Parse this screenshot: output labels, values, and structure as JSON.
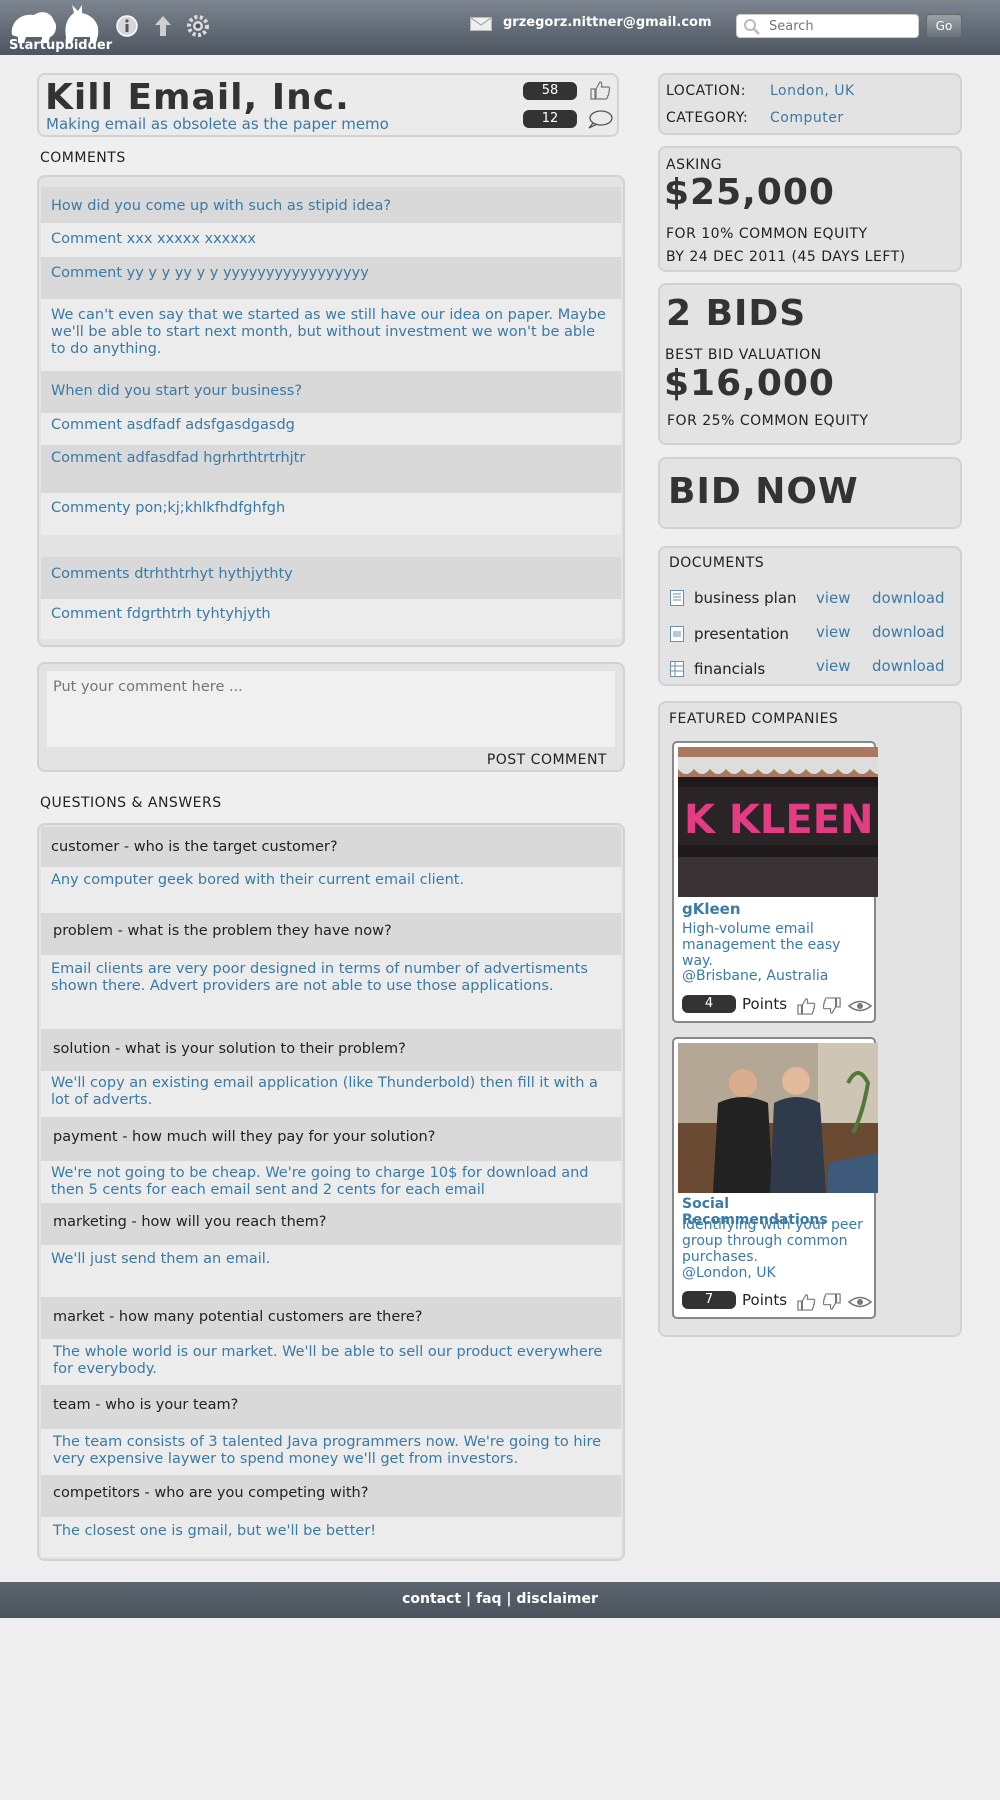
{
  "header": {
    "brand": "Startupbidder",
    "email": "grzegorz.nittner@gmail.com",
    "search_placeholder": "Search",
    "go_label": "Go"
  },
  "company": {
    "name": "Kill Email, Inc.",
    "tagline": "Making email as obsolete as the paper memo",
    "likes": "58",
    "comment_count": "12"
  },
  "comments": {
    "heading": "COMMENTS",
    "items": [
      "How did you come up with such as stipid idea?",
      "Comment xxx xxxxx xxxxxx",
      "Comment yy y y yy y y yyyyyyyyyyyyyyyyy",
      "We can't even say that we started as we still have our idea on paper. Maybe we'll be able to start next month, but without investment we won't be able to do anything.",
      "When did you start your business?",
      "Comment asdfadf adsfgasdgasdg",
      "Comment adfasdfad hgrhrthtrtrhjtr",
      "Commenty pon;kj;khlkfhdfghfgh",
      "Comments dtrhthtrhyt hythjythty",
      "Comment fdgrthtrh tyhtyhjyth"
    ],
    "input_placeholder": "Put your comment here ...",
    "post_label": "POST COMMENT"
  },
  "qa": {
    "heading": "QUESTIONS & ANSWERS",
    "items": [
      {
        "q": "customer - who is the target customer?",
        "a": "Any computer geek bored with their current email client."
      },
      {
        "q": "problem - what is the problem they have now?",
        "a": "Email clients are very poor designed in terms of number of advertisments shown there. Advert providers are not able to use those applications."
      },
      {
        "q": "solution - what is your solution to their problem?",
        "a": "We'll copy an existing email application (like Thunderbold) then fill it with a lot of adverts."
      },
      {
        "q": "payment - how much will they pay for your solution?",
        "a": "We're not going to be cheap. We're going to charge 10$ for download and then 5 cents for each email sent and 2 cents for each email"
      },
      {
        "q": "marketing - how will you reach them?",
        "a": "We'll just send them an email."
      },
      {
        "q": "market - how many potential customers are there?",
        "a": "The whole world is our market. We'll be able to sell our product everywhere for everybody."
      },
      {
        "q": "team - who is your team?",
        "a": "The team consists of 3 talented Java programmers now. We're going to hire very expensive laywer to spend money we'll get from investors."
      },
      {
        "q": "competitors - who are you competing with?",
        "a": "The closest one is gmail, but we'll be better!"
      }
    ]
  },
  "info": {
    "location_label": "LOCATION:",
    "location_value": "London, UK",
    "category_label": "CATEGORY:",
    "category_value": "Computer"
  },
  "asking": {
    "label": "ASKING",
    "amount": "$25,000",
    "equity": "FOR 10% COMMON EQUITY",
    "deadline": "BY 24 DEC 2011 (45 DAYS LEFT)"
  },
  "bids": {
    "count": "2 BIDS",
    "best_label": "BEST BID VALUATION",
    "best_amount": "$16,000",
    "best_equity": "FOR 25% COMMON EQUITY"
  },
  "bid_now": "BID NOW",
  "documents": {
    "heading": "DOCUMENTS",
    "items": [
      {
        "name": "business plan",
        "view": "view",
        "download": "download"
      },
      {
        "name": "presentation",
        "view": "view",
        "download": "download"
      },
      {
        "name": "financials",
        "view": "view",
        "download": "download"
      }
    ]
  },
  "featured": {
    "heading": "FEATURED COMPANIES",
    "items": [
      {
        "name": "gKleen",
        "desc": "High-volume email management the easy way.",
        "location": "@Brisbane, Australia",
        "points": "4",
        "points_label": "Points",
        "sign_text": "K KLEEN"
      },
      {
        "name": "Social Recommendations",
        "desc": "Identifying with your peer group through common purchases.",
        "location": "@London, UK",
        "points": "7",
        "points_label": "Points"
      }
    ]
  },
  "footer": {
    "contact": "contact",
    "faq": "faq",
    "disclaimer": "disclaimer",
    "sep": "|"
  }
}
